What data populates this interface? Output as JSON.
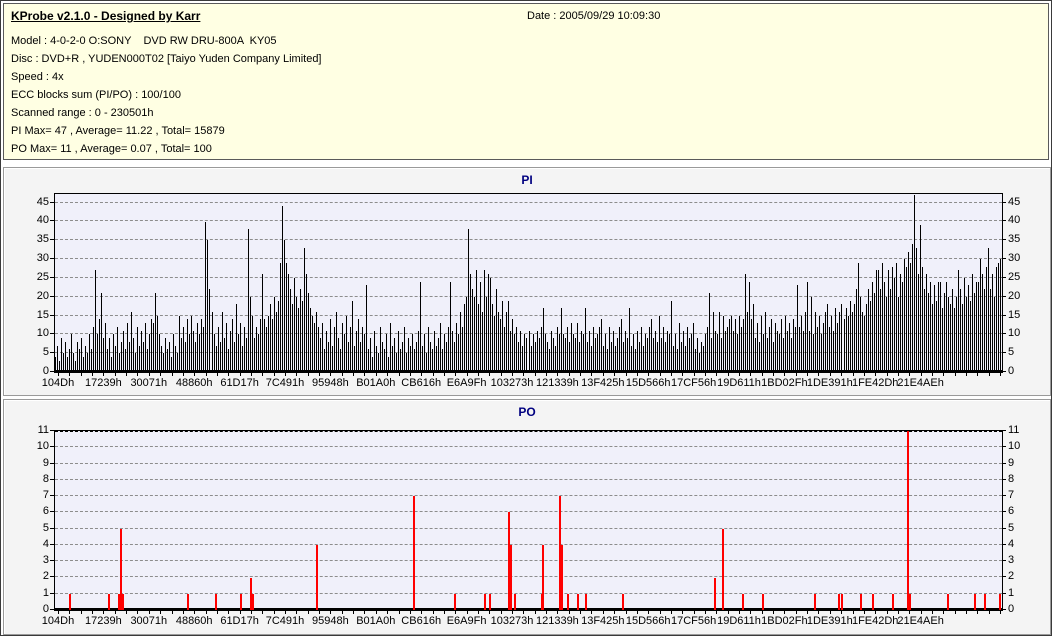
{
  "window": {
    "title": "KProbe scan report",
    "border_color": "#3a3a3a"
  },
  "header": {
    "bg": "#FFFFE3",
    "title": "KProbe v2.1.0 - Designed by Karr",
    "date": "Date : 2005/09/29 10:09:30",
    "info_lines": [
      "Model : 4-0-2-0 O:SONY    DVD RW DRU-800A  KY05",
      "Disc : DVD+R , YUDEN000T02 [Taiyo Yuden Company Limited]",
      "Speed : 4x",
      "ECC blocks sum (PI/PO) : 100/100",
      "Scanned range : 0 - 230501h",
      "PI Max= 47 , Average= 11.22 , Total= 15879",
      "PO Max= 11 , Average= 0.07 , Total= 100"
    ]
  },
  "chart_data": [
    {
      "id": "pi",
      "type": "bar",
      "title": "PI",
      "title_color": "#000080",
      "bar_color": "#000000",
      "grid": true,
      "legend": "none",
      "ylim": [
        0,
        47.3
      ],
      "y_ticks": [
        0,
        5,
        10,
        15,
        20,
        25,
        30,
        35,
        40,
        45
      ],
      "x_tick_labels": [
        "104Dh",
        "17239h",
        "30071h",
        "48860h",
        "61D17h",
        "7C491h",
        "95948h",
        "B01A0h",
        "CB616h",
        "E6A9Fh",
        "103273h",
        "121339h",
        "13F425h",
        "15D566h",
        "17CF56h",
        "19D611h",
        "1BD02Fh",
        "1DE391h",
        "1FE42Dh",
        "21E4AEh"
      ],
      "stats": {
        "max": 47,
        "average": 11.22,
        "total": 15879
      },
      "values": [
        4,
        7,
        3,
        9,
        5,
        8,
        4,
        6,
        10,
        5,
        3,
        8,
        6,
        9,
        4,
        7,
        5,
        10,
        6,
        12,
        27,
        10,
        14,
        21,
        9,
        13,
        6,
        9,
        4,
        10,
        7,
        12,
        5,
        8,
        11,
        6,
        13,
        8,
        16,
        9,
        5,
        12,
        7,
        11,
        8,
        13,
        6,
        10,
        14,
        13,
        21,
        15,
        10,
        7,
        5,
        9,
        6,
        8,
        4,
        10,
        7,
        5,
        15,
        9,
        12,
        8,
        14,
        10,
        15,
        11,
        8,
        13,
        10,
        14,
        12,
        40,
        35,
        22,
        16,
        10,
        7,
        12,
        8,
        16,
        9,
        13,
        6,
        11,
        14,
        8,
        18,
        10,
        13,
        7,
        12,
        9,
        38,
        20,
        15,
        9,
        12,
        10,
        14,
        26,
        14,
        12,
        15,
        18,
        14,
        20,
        16,
        19,
        29,
        44,
        35,
        29,
        26,
        22,
        18,
        25,
        20,
        17,
        22,
        19,
        33,
        26,
        21,
        17,
        15,
        13,
        16,
        12,
        9,
        13,
        6,
        11,
        8,
        14,
        7,
        12,
        16,
        9,
        6,
        13,
        10,
        15,
        8,
        12,
        19,
        7,
        11,
        14,
        8,
        12,
        10,
        23,
        6,
        9,
        4,
        11,
        7,
        5,
        12,
        8,
        6,
        10,
        4,
        13,
        7,
        9,
        5,
        11,
        6,
        8,
        12,
        5,
        9,
        7,
        10,
        6,
        8,
        11,
        24,
        7,
        10,
        5,
        12,
        8,
        6,
        11,
        7,
        9,
        13,
        6,
        10,
        8,
        12,
        24,
        11,
        8,
        13,
        10,
        16,
        12,
        18,
        20,
        38,
        26,
        22,
        20,
        27,
        18,
        24,
        16,
        27,
        20,
        26,
        25,
        18,
        15,
        22,
        16,
        14,
        19,
        12,
        16,
        19,
        11,
        14,
        10,
        12,
        8,
        11,
        7,
        10,
        9,
        11,
        7,
        10,
        8,
        11,
        9,
        12,
        17,
        10,
        8,
        6,
        11,
        9,
        7,
        12,
        10,
        17,
        10,
        9,
        12,
        8,
        13,
        10,
        9,
        13,
        8,
        11,
        10,
        17,
        8,
        11,
        7,
        12,
        9,
        10,
        12,
        14,
        7,
        10,
        6,
        12,
        8,
        11,
        7,
        9,
        12,
        14,
        8,
        11,
        9,
        17,
        7,
        10,
        6,
        11,
        8,
        12,
        7,
        10,
        9,
        12,
        14,
        9,
        11,
        8,
        15,
        9,
        12,
        8,
        11,
        10,
        19,
        7,
        10,
        6,
        13,
        8,
        11,
        7,
        12,
        9,
        10,
        13,
        6,
        9,
        5,
        8,
        7,
        10,
        12,
        21,
        9,
        16,
        11,
        10,
        16,
        9,
        15,
        11,
        12,
        14,
        15,
        11,
        14,
        10,
        15,
        12,
        14,
        26,
        16,
        24,
        14,
        18,
        9,
        13,
        8,
        15,
        10,
        16,
        9,
        12,
        14,
        8,
        13,
        11,
        10,
        14,
        9,
        15,
        11,
        13,
        9,
        14,
        12,
        23,
        12,
        15,
        11,
        16,
        24,
        11,
        20,
        10,
        16,
        12,
        15,
        10,
        13,
        16,
        18,
        12,
        15,
        11,
        17,
        13,
        16,
        18,
        14,
        17,
        15,
        19,
        16,
        18,
        22,
        29,
        20,
        16,
        15,
        18,
        22,
        19,
        24,
        21,
        27,
        27,
        22,
        29,
        24,
        20,
        27,
        22,
        28,
        25,
        29,
        20,
        26,
        24,
        30,
        28,
        32,
        29,
        34,
        47,
        33,
        26,
        39,
        28,
        22,
        26,
        21,
        24,
        18,
        23,
        19,
        24,
        24,
        17,
        21,
        24,
        20,
        18,
        22,
        17,
        20,
        27,
        22,
        18,
        25,
        20,
        23,
        19,
        26,
        21,
        24,
        24,
        30,
        26,
        22,
        28,
        33,
        22,
        26,
        20,
        28,
        29,
        30
      ]
    },
    {
      "id": "po",
      "type": "bar",
      "title": "PO",
      "title_color": "#000080",
      "bar_color": "#FF0000",
      "grid": true,
      "legend": "none",
      "ylim": [
        0,
        11
      ],
      "y_ticks": [
        0,
        1,
        2,
        3,
        4,
        5,
        6,
        7,
        8,
        9,
        10,
        11
      ],
      "x_tick_labels": [
        "104Dh",
        "17239h",
        "30071h",
        "48860h",
        "61D17h",
        "7C491h",
        "95948h",
        "B01A0h",
        "CB616h",
        "E6A9Fh",
        "103273h",
        "121339h",
        "13F425h",
        "15D566h",
        "17CF56h",
        "19D611h",
        "1BD02Fh",
        "1DE391h",
        "1FE42Dh",
        "21E4AEh"
      ],
      "stats": {
        "max": 11,
        "average": 0.07,
        "total": 100
      },
      "points": [
        {
          "x": 0.0148,
          "v": 1
        },
        {
          "x": 0.056,
          "v": 1
        },
        {
          "x": 0.0665,
          "v": 1
        },
        {
          "x": 0.0681,
          "v": 5
        },
        {
          "x": 0.0702,
          "v": 1
        },
        {
          "x": 0.1394,
          "v": 1
        },
        {
          "x": 0.1689,
          "v": 1
        },
        {
          "x": 0.1954,
          "v": 1
        },
        {
          "x": 0.2059,
          "v": 2
        },
        {
          "x": 0.208,
          "v": 1
        },
        {
          "x": 0.2756,
          "v": 4
        },
        {
          "x": 0.378,
          "v": 7
        },
        {
          "x": 0.4213,
          "v": 1
        },
        {
          "x": 0.453,
          "v": 1
        },
        {
          "x": 0.4583,
          "v": 1
        },
        {
          "x": 0.4783,
          "v": 6
        },
        {
          "x": 0.4805,
          "v": 4
        },
        {
          "x": 0.4847,
          "v": 1
        },
        {
          "x": 0.5132,
          "v": 1
        },
        {
          "x": 0.5143,
          "v": 4
        },
        {
          "x": 0.5322,
          "v": 7
        },
        {
          "x": 0.5338,
          "v": 4
        },
        {
          "x": 0.5407,
          "v": 1
        },
        {
          "x": 0.5512,
          "v": 1
        },
        {
          "x": 0.5597,
          "v": 1
        },
        {
          "x": 0.5987,
          "v": 1
        },
        {
          "x": 0.6958,
          "v": 2
        },
        {
          "x": 0.7043,
          "v": 5
        },
        {
          "x": 0.7254,
          "v": 1
        },
        {
          "x": 0.7466,
          "v": 1
        },
        {
          "x": 0.8015,
          "v": 1
        },
        {
          "x": 0.8268,
          "v": 1
        },
        {
          "x": 0.83,
          "v": 1
        },
        {
          "x": 0.8501,
          "v": 1
        },
        {
          "x": 0.8627,
          "v": 1
        },
        {
          "x": 0.8838,
          "v": 1
        },
        {
          "x": 0.8997,
          "v": 11
        },
        {
          "x": 0.9018,
          "v": 1
        },
        {
          "x": 0.9419,
          "v": 1
        },
        {
          "x": 0.9704,
          "v": 1
        },
        {
          "x": 0.981,
          "v": 1
        },
        {
          "x": 0.9968,
          "v": 1
        }
      ]
    }
  ]
}
